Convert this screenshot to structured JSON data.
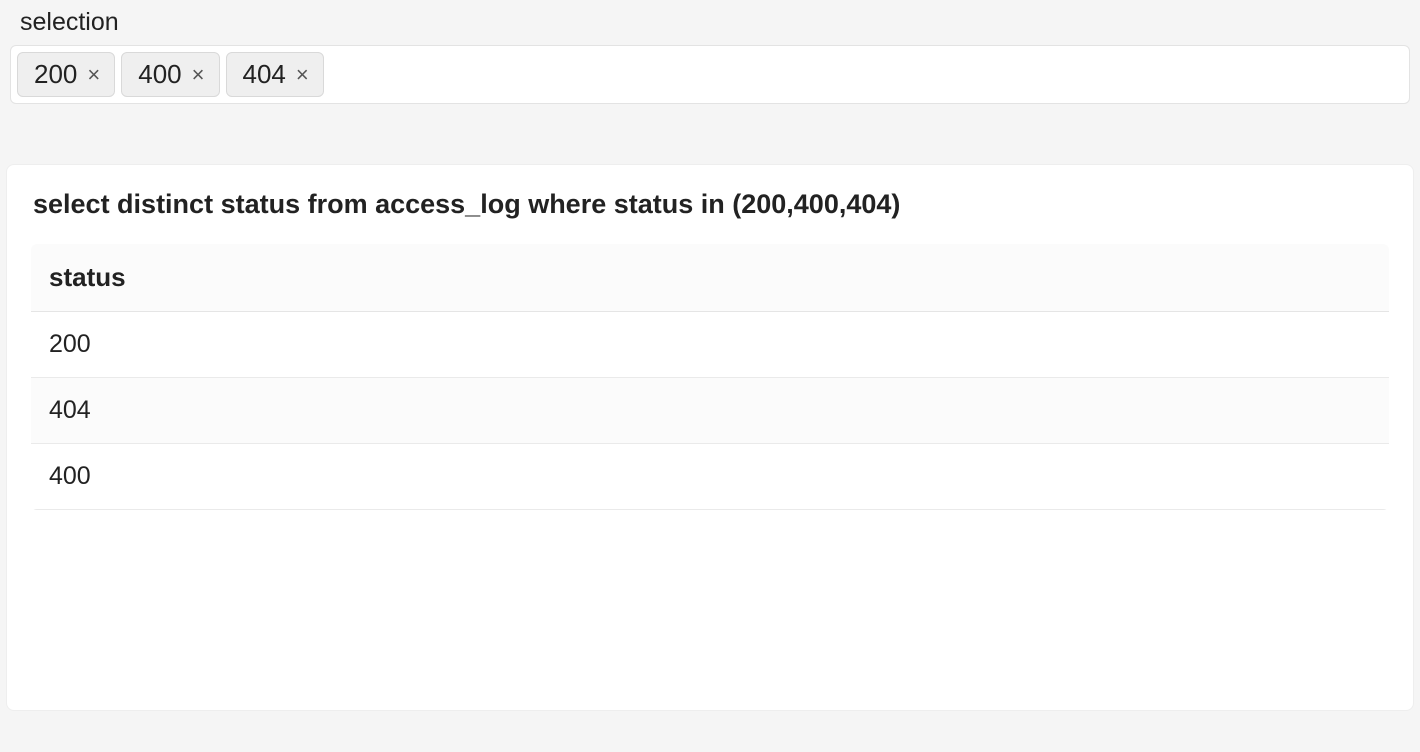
{
  "selection": {
    "label": "selection",
    "chips": [
      {
        "value": "200"
      },
      {
        "value": "400"
      },
      {
        "value": "404"
      }
    ],
    "chip_close_glyph": "×"
  },
  "results": {
    "query": "select distinct status from access_log where status in (200,400,404)",
    "columns": [
      "status"
    ],
    "rows": [
      {
        "status": "200"
      },
      {
        "status": "404"
      },
      {
        "status": "400"
      }
    ]
  }
}
